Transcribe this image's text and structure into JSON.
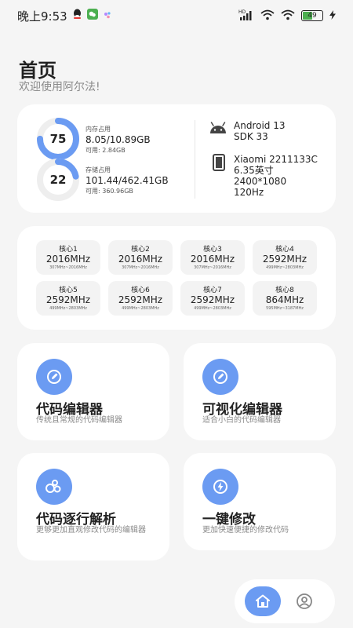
{
  "status_bar": {
    "time": "晚上9:53",
    "battery": "49"
  },
  "header": {
    "title": "首页",
    "subtitle": "欢迎使用阿尔法!"
  },
  "memory": {
    "percent": "75",
    "fraction": 0.75,
    "title": "内存占用",
    "value": "8.05/10.89GB",
    "available": "可用: 2.84GB"
  },
  "storage": {
    "percent": "22",
    "fraction": 0.22,
    "title": "存储占用",
    "value": "101.44/462.41GB",
    "available": "可用: 360.96GB"
  },
  "device": {
    "os_line1": "Android 13",
    "os_line2": "SDK 33",
    "model": "Xiaomi 2211133C",
    "screen_size": "6.35英寸",
    "resolution": "2400*1080",
    "refresh": "120Hz"
  },
  "cores": [
    {
      "name": "核心1",
      "freq": "2016MHz",
      "range": "307MHz~2016MHz"
    },
    {
      "name": "核心2",
      "freq": "2016MHz",
      "range": "307MHz~2016MHz"
    },
    {
      "name": "核心3",
      "freq": "2016MHz",
      "range": "307MHz~2016MHz"
    },
    {
      "name": "核心4",
      "freq": "2592MHz",
      "range": "499MHz~2803MHz"
    },
    {
      "name": "核心5",
      "freq": "2592MHz",
      "range": "499MHz~2803MHz"
    },
    {
      "name": "核心6",
      "freq": "2592MHz",
      "range": "499MHz~2803MHz"
    },
    {
      "name": "核心7",
      "freq": "2592MHz",
      "range": "499MHz~2803MHz"
    },
    {
      "name": "核心8",
      "freq": "864MHz",
      "range": "595MHz~3187MHz"
    }
  ],
  "features": [
    {
      "title": "代码编辑器",
      "desc": "传统且常规的代码编辑器",
      "icon": "edit-icon"
    },
    {
      "title": "可视化编辑器",
      "desc": "适合小白的代码编辑器",
      "icon": "edit-icon"
    },
    {
      "title": "代码逐行解析",
      "desc": "更够更加直观修改代码的编辑器",
      "icon": "bubbles-icon"
    },
    {
      "title": "一键修改",
      "desc": "更加快速便捷的修改代码",
      "icon": "bolt-icon"
    }
  ],
  "colors": {
    "accent": "#6b9bf2",
    "ring_track": "#eeeeee",
    "card": "#ffffff",
    "background": "#f5f5f5"
  }
}
